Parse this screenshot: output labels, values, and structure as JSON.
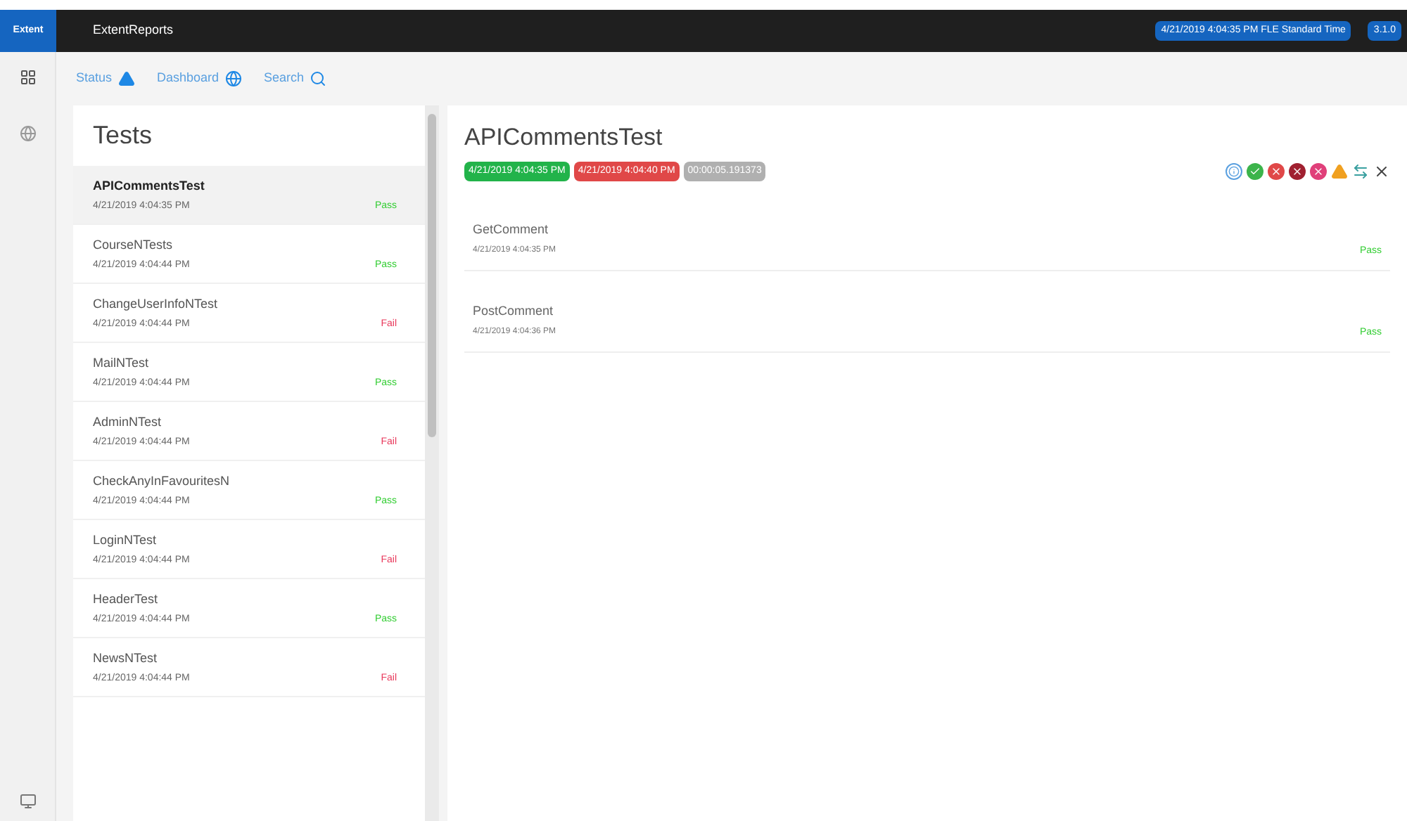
{
  "brand": {
    "logo": "Extent",
    "title": "ExtentReports",
    "time": "4/21/2019 4:04:35 PM FLE Standard Time",
    "version": "3.1.0"
  },
  "subnav": [
    {
      "label": "Status",
      "kind": "status"
    },
    {
      "label": "Dashboard",
      "kind": "dashboard"
    },
    {
      "label": "Search",
      "kind": "search"
    }
  ],
  "tests": {
    "title": "Tests",
    "items": [
      {
        "name": "APICommentsTest",
        "time": "4/21/2019 4:04:35 PM",
        "status": "Pass",
        "kind": "pass",
        "selected": true
      },
      {
        "name": "CourseNTests",
        "time": "4/21/2019 4:04:44 PM",
        "status": "Pass",
        "kind": "pass",
        "selected": false
      },
      {
        "name": "ChangeUserInfoNTest",
        "time": "4/21/2019 4:04:44 PM",
        "status": "Fail",
        "kind": "fail",
        "selected": false
      },
      {
        "name": "MailNTest",
        "time": "4/21/2019 4:04:44 PM",
        "status": "Pass",
        "kind": "pass",
        "selected": false
      },
      {
        "name": "AdminNTest",
        "time": "4/21/2019 4:04:44 PM",
        "status": "Fail",
        "kind": "fail",
        "selected": false
      },
      {
        "name": "CheckAnyInFavouritesN",
        "time": "4/21/2019 4:04:44 PM",
        "status": "Pass",
        "kind": "pass",
        "selected": false
      },
      {
        "name": "LoginNTest",
        "time": "4/21/2019 4:04:44 PM",
        "status": "Fail",
        "kind": "fail",
        "selected": false
      },
      {
        "name": "HeaderTest",
        "time": "4/21/2019 4:04:44 PM",
        "status": "Pass",
        "kind": "pass",
        "selected": false
      },
      {
        "name": "NewsNTest",
        "time": "4/21/2019 4:04:44 PM",
        "status": "Fail",
        "kind": "fail",
        "selected": false
      }
    ]
  },
  "detail": {
    "title": "APICommentsTest",
    "badges": [
      {
        "text": "4/21/2019 4:04:35 PM",
        "kind": "start"
      },
      {
        "text": "4/21/2019 4:04:40 PM",
        "kind": "end"
      },
      {
        "text": "00:00:05.191373",
        "kind": "duration"
      }
    ],
    "steps": [
      {
        "name": "GetComment",
        "time": "4/21/2019 4:04:35 PM",
        "status": "Pass",
        "kind": "pass"
      },
      {
        "name": "PostComment",
        "time": "4/21/2019 4:04:36 PM",
        "status": "Pass",
        "kind": "pass"
      }
    ]
  }
}
